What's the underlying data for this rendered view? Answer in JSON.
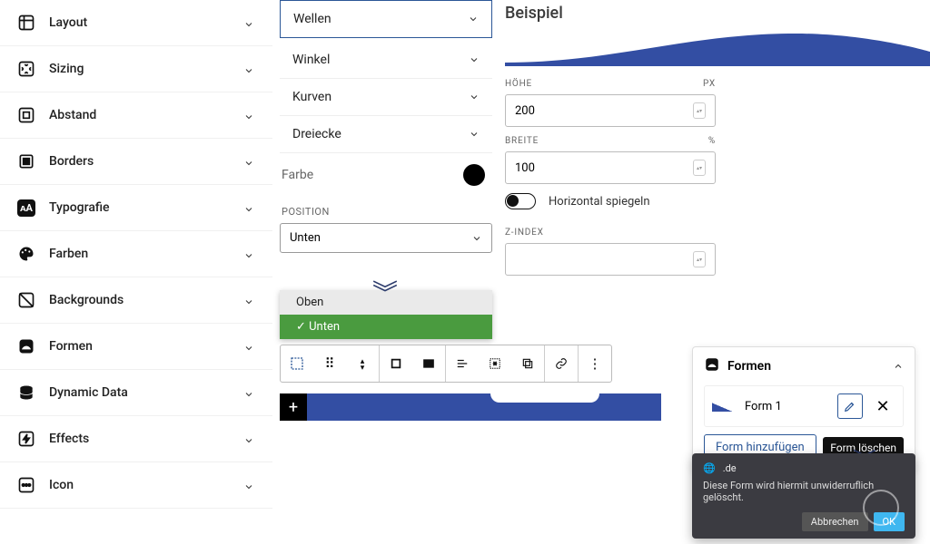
{
  "sidebar": {
    "items": [
      {
        "label": "Layout"
      },
      {
        "label": "Sizing"
      },
      {
        "label": "Abstand"
      },
      {
        "label": "Borders"
      },
      {
        "label": "Typografie"
      },
      {
        "label": "Farben"
      },
      {
        "label": "Backgrounds"
      },
      {
        "label": "Formen"
      },
      {
        "label": "Dynamic Data"
      },
      {
        "label": "Effects"
      },
      {
        "label": "Icon"
      }
    ]
  },
  "shapes": {
    "selected": "Wellen",
    "options": [
      "Winkel",
      "Kurven",
      "Dreiecke"
    ],
    "color_label": "Farbe",
    "color": "#000000"
  },
  "position": {
    "label": "POSITION",
    "value": "Unten",
    "options": [
      "Oben",
      "Unten"
    ]
  },
  "preview": {
    "title": "Beispiel",
    "height_label": "HÖHE",
    "height_unit": "px",
    "height_value": "200",
    "width_label": "BREITE",
    "width_unit": "%",
    "width_value": "100",
    "mirror_label": "Horizontal spiegeln",
    "zindex_label": "Z-INDEX",
    "zindex_value": ""
  },
  "forms": {
    "title": "Formen",
    "item_label": "Form 1",
    "add_label": "Form hinzufügen",
    "delete_label": "Form löschen"
  },
  "toast": {
    "domain": ".de",
    "message": "Diese Form wird hiermit unwiderruflich gelöscht.",
    "cancel": "Abbrechen",
    "ok": "OK"
  },
  "colors": {
    "accent": "#334ea3",
    "green": "#4a9b3f"
  }
}
